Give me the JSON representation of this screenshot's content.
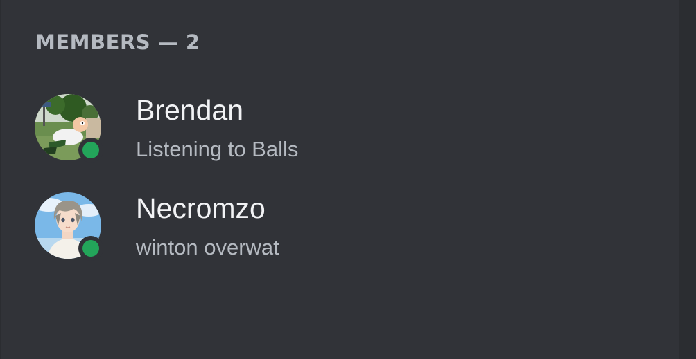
{
  "members_panel": {
    "header": "MEMBERS — 2",
    "status_color": "#23a55a",
    "members": [
      {
        "name": "Brendan",
        "activity": "Listening to Balls",
        "avatar": "cartoon-character-avatar",
        "status": "online"
      },
      {
        "name": "Necromzo",
        "activity": "winton overwat",
        "avatar": "anime-character-avatar",
        "status": "online"
      }
    ]
  }
}
